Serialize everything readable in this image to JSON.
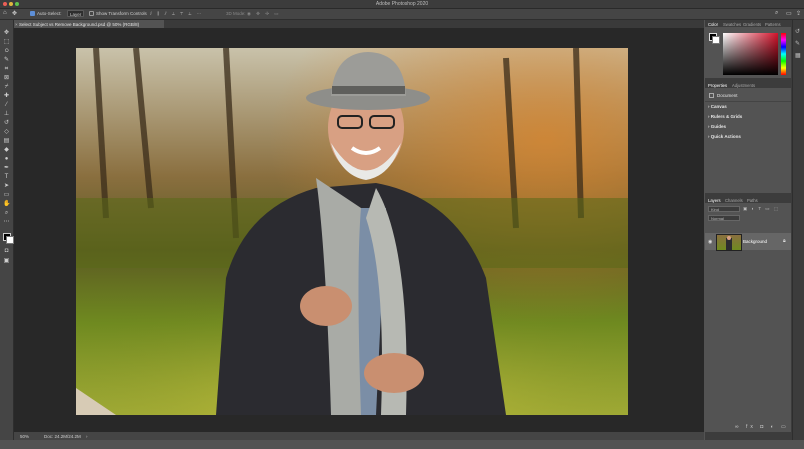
{
  "window": {
    "title": "Adobe Photoshop 2020"
  },
  "options_bar": {
    "auto_select_label": "Auto-Select:",
    "auto_select_value": "Layer",
    "transform_label": "Show Transform Controls",
    "mode_label": "3D Mode:"
  },
  "document": {
    "tab_label": "Select Subject vs Remove Background.psd @ 50% (RGB/8)"
  },
  "status": {
    "zoom": "50%",
    "doc_size": "Doc: 24.2M/24.2M"
  },
  "panels": {
    "color_tabs": [
      "Color",
      "Swatches",
      "Gradients",
      "Patterns"
    ],
    "props_tabs": [
      "Properties",
      "Adjustments"
    ],
    "props_document_label": "Document",
    "props_sections": [
      "Canvas",
      "Rulers & Grids",
      "Guides",
      "Quick Actions"
    ],
    "layers_tabs": [
      "Layers",
      "Channels",
      "Paths"
    ],
    "layers_filter": "Kind",
    "layers_blend": "Normal",
    "layer_name": "Background"
  },
  "colors": {
    "accent": "#d4132b",
    "panel": "#535353",
    "canvas_bg": "#282828"
  },
  "icons": [
    "move-icon",
    "marquee-icon",
    "lasso-icon",
    "quick-selection-icon",
    "crop-icon",
    "frame-icon",
    "eyedropper-icon",
    "healing-brush-icon",
    "brush-icon",
    "clone-stamp-icon",
    "history-brush-icon",
    "eraser-icon",
    "gradient-icon",
    "blur-icon",
    "dodge-icon",
    "pen-icon",
    "type-icon",
    "path-selection-icon",
    "rectangle-icon",
    "hand-icon",
    "zoom-icon",
    "more-icon"
  ]
}
